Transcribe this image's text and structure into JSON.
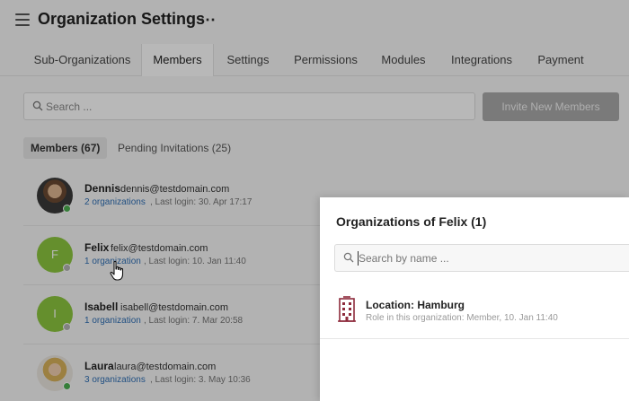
{
  "header": {
    "title": "Organization Settings",
    "more_label": "⋯"
  },
  "tabs": [
    {
      "label": "Sub-Organizations",
      "active": false
    },
    {
      "label": "Members",
      "active": true
    },
    {
      "label": "Settings",
      "active": false
    },
    {
      "label": "Permissions",
      "active": false
    },
    {
      "label": "Modules",
      "active": false
    },
    {
      "label": "Integrations",
      "active": false
    },
    {
      "label": "Payment",
      "active": false
    }
  ],
  "search": {
    "placeholder": "Search ..."
  },
  "invite_button": {
    "label": "Invite New Members"
  },
  "subtabs": {
    "members_label": "Members (67)",
    "pending_label": "Pending Invitations (25)"
  },
  "members": [
    {
      "name": "Dennis",
      "email": "dennis@testdomain.com",
      "orgs": "2 organizations",
      "login": ", Last login: 30. Apr 17:17",
      "initial": "",
      "status": "online"
    },
    {
      "name": "Felix",
      "email": "felix@testdomain.com",
      "orgs": "1 organization",
      "login": ", Last login: 10. Jan 11:40",
      "initial": "F",
      "status": "offline"
    },
    {
      "name": "Isabell",
      "email": "isabell@testdomain.com",
      "orgs": "1 organization",
      "login": ", Last login: 7. Mar 20:58",
      "initial": "I",
      "status": "offline"
    },
    {
      "name": "Laura",
      "email": "laura@testdomain.com",
      "orgs": "3 organizations",
      "login": ", Last login: 3. May 10:36",
      "initial": "",
      "status": "online"
    }
  ],
  "panel": {
    "title": "Organizations of Felix (1)",
    "search_placeholder": "Search by name ...",
    "orgs": [
      {
        "name": "Location: Hamburg",
        "role": "Role in this organization: Member, 10. Jan 11:40"
      }
    ]
  },
  "colors": {
    "link": "#2f6fb5",
    "avatar_green": "#8cc63f",
    "online": "#4caf50",
    "offline": "#b5b5b5",
    "building_icon": "#8e2b3c"
  },
  "icons": {
    "menu": "hamburger-icon",
    "search": "search-icon",
    "building": "building-icon",
    "cursor": "hand-pointer-icon"
  }
}
